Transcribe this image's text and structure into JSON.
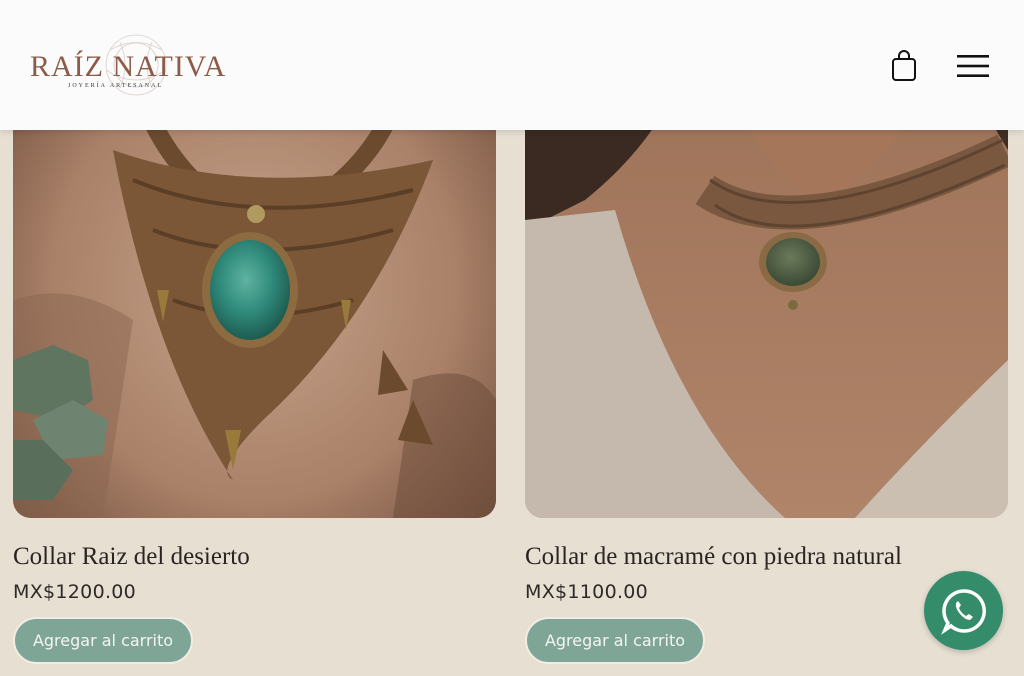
{
  "brand": {
    "name": "RAÍZ NATIVA",
    "tagline": "JOYERÍA ARTESANAL"
  },
  "header": {
    "cart_icon": "shopping-bag-icon",
    "menu_icon": "hamburger-menu-icon"
  },
  "products": [
    {
      "title": "Collar Raiz del desierto",
      "price": "MX$1200.00",
      "button_label": "Agregar al carrito",
      "image": "macrame-necklace-turquoise-stone-on-rock"
    },
    {
      "title": "Collar de macramé con piedra natural",
      "price": "MX$1100.00",
      "button_label": "Agregar al carrito",
      "image": "macrame-choker-on-model-neck"
    }
  ],
  "floating": {
    "whatsapp_icon": "whatsapp-icon"
  },
  "colors": {
    "background": "#e6dfd2",
    "header": "#fbfbfb",
    "button": "#7fa596",
    "whatsapp": "#348c6b",
    "logo": "#8c5b49"
  }
}
